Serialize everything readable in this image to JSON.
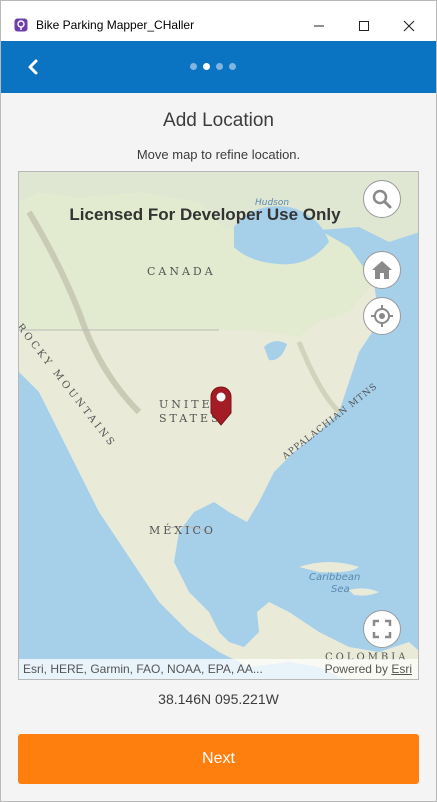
{
  "window": {
    "title": "Bike Parking Mapper_CHaller",
    "controls": [
      "minimize",
      "maximize",
      "close"
    ]
  },
  "navbar": {
    "back_icon": "chevron-left-icon",
    "pages": 4,
    "current_page": 2
  },
  "page": {
    "title": "Add Location",
    "subtitle": "Move map to refine location."
  },
  "map": {
    "watermark": "Licensed For Developer Use Only",
    "labels": {
      "canada": "CANADA",
      "rocky_mountains": "ROCKY MOUNTAINS",
      "united_states_1": "UNITED",
      "united_states_2": "STATES",
      "appalachian": "APPALACHIAN MTNS",
      "mexico": "MÉXICO",
      "hudson": "Hudson",
      "caribbean_1": "Caribbean",
      "caribbean_2": "Sea",
      "colombia": "COLOMBIA"
    },
    "buttons": [
      "search-icon",
      "home-icon",
      "locate-icon",
      "fullscreen-icon"
    ],
    "attribution_left": "Esri, HERE, Garmin, FAO, NOAA, EPA, AA...",
    "attribution_powered": "Powered by",
    "attribution_link": "Esri"
  },
  "coordinates": "38.146N 095.221W",
  "next_label": "Next",
  "colors": {
    "navbar": "#0a74c3",
    "next_button": "#ff7f0e",
    "marker": "#a51d24",
    "water": "#a6d0ea",
    "land": "#e9ead8"
  }
}
